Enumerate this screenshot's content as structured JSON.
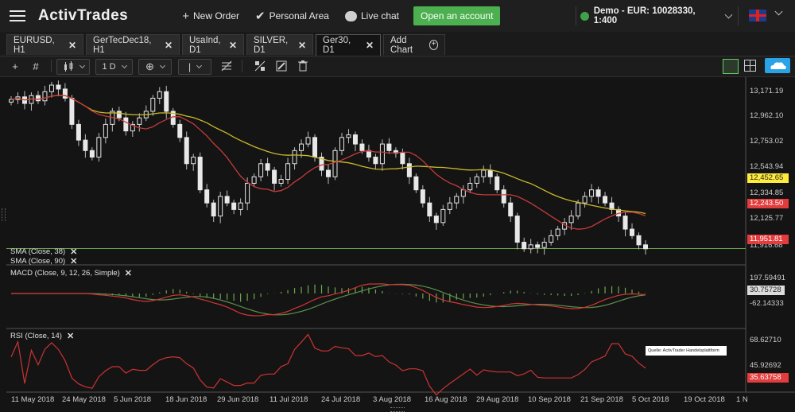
{
  "nav": {
    "logo": "ActivTrades",
    "new_order": "New Order",
    "personal_area": "Personal Area",
    "live_chat": "Live chat",
    "open_account": "Open an account",
    "account": "Demo - EUR: 10028330, 1:400"
  },
  "tabs": [
    {
      "label": "EURUSD, H1"
    },
    {
      "label": "GerTecDec18, H1"
    },
    {
      "label": "UsaInd, D1"
    },
    {
      "label": "SILVER, D1"
    },
    {
      "label": "Ger30, D1"
    }
  ],
  "add_chart": "Add Chart",
  "toolbar": {
    "timeframe": "1 D"
  },
  "colors": {
    "bull_candle": "#e8e8e8",
    "bear_candle": "#e8e8e8",
    "sma38": "#c43a3a",
    "sma90": "#c9b82a",
    "macd_line": "#d33535",
    "signal_line": "#5a8f4a",
    "rsi_line": "#cc3333",
    "current_price": "#e03c3c",
    "price_line": "#6aa84f"
  },
  "panes": {
    "sma38_label": "SMA (Close, 38)",
    "sma90_label": "SMA (Close, 90)",
    "macd_label": "MACD (Close, 9, 12, 26, Simple)",
    "rsi_label": "RSI (Close, 14)"
  },
  "price_axis": [
    "13,171.19",
    "12,962.10",
    "12,753.02",
    "12,543.94",
    "12,334.85",
    "12,125.77",
    "11,916.68"
  ],
  "price_tags": {
    "sma90": "12,452.65",
    "sma38": "12,243.50",
    "current": "11,951.81"
  },
  "macd_axis": [
    "197.59491",
    "-62.14333"
  ],
  "macd_tags": {
    "signal": "30.75728"
  },
  "rsi_axis": [
    "68.62710",
    "45.92692"
  ],
  "rsi_tag": "35.63758",
  "source_note": "Quelle: ActivTrader Handelsplattform",
  "x_axis": [
    "11 May 2018",
    "24 May 2018",
    "5 Jun 2018",
    "18 Jun 2018",
    "29 Jun 2018",
    "11 Jul 2018",
    "24 Jul 2018",
    "3 Aug 2018",
    "16 Aug 2018",
    "29 Aug 2018",
    "10 Sep 2018",
    "21 Sep 2018",
    "5 Oct 2018",
    "19 Oct 2018",
    "1 N"
  ],
  "chart_data": {
    "type": "candlestick",
    "series_price": {
      "close": [
        13090,
        13110,
        13060,
        13120,
        13080,
        13150,
        13200,
        13170,
        13100,
        12900,
        12780,
        12700,
        12650,
        12800,
        12900,
        13000,
        12950,
        12850,
        12900,
        12950,
        13000,
        13100,
        13150,
        13000,
        12900,
        12800,
        12600,
        12650,
        12400,
        12300,
        12200,
        12350,
        12300,
        12250,
        12300,
        12450,
        12500,
        12600,
        12550,
        12450,
        12480,
        12600,
        12700,
        12750,
        12800,
        12650,
        12550,
        12500,
        12700,
        12800,
        12820,
        12750,
        12700,
        12650,
        12600,
        12750,
        12700,
        12680,
        12600,
        12500,
        12400,
        12300,
        12200,
        12150,
        12250,
        12300,
        12350,
        12400,
        12450,
        12500,
        12550,
        12500,
        12400,
        12300,
        12200,
        12000,
        11950,
        11980,
        11960,
        12000,
        12050,
        12100,
        12150,
        12200,
        12300,
        12350,
        12400,
        12350,
        12300,
        12250,
        12200,
        12100,
        12050,
        11980,
        11950
      ],
      "sma38_last": 12243.5,
      "sma90_last": 12452.65,
      "current": 11951.81
    },
    "ylim": [
      11900,
      13200
    ]
  }
}
